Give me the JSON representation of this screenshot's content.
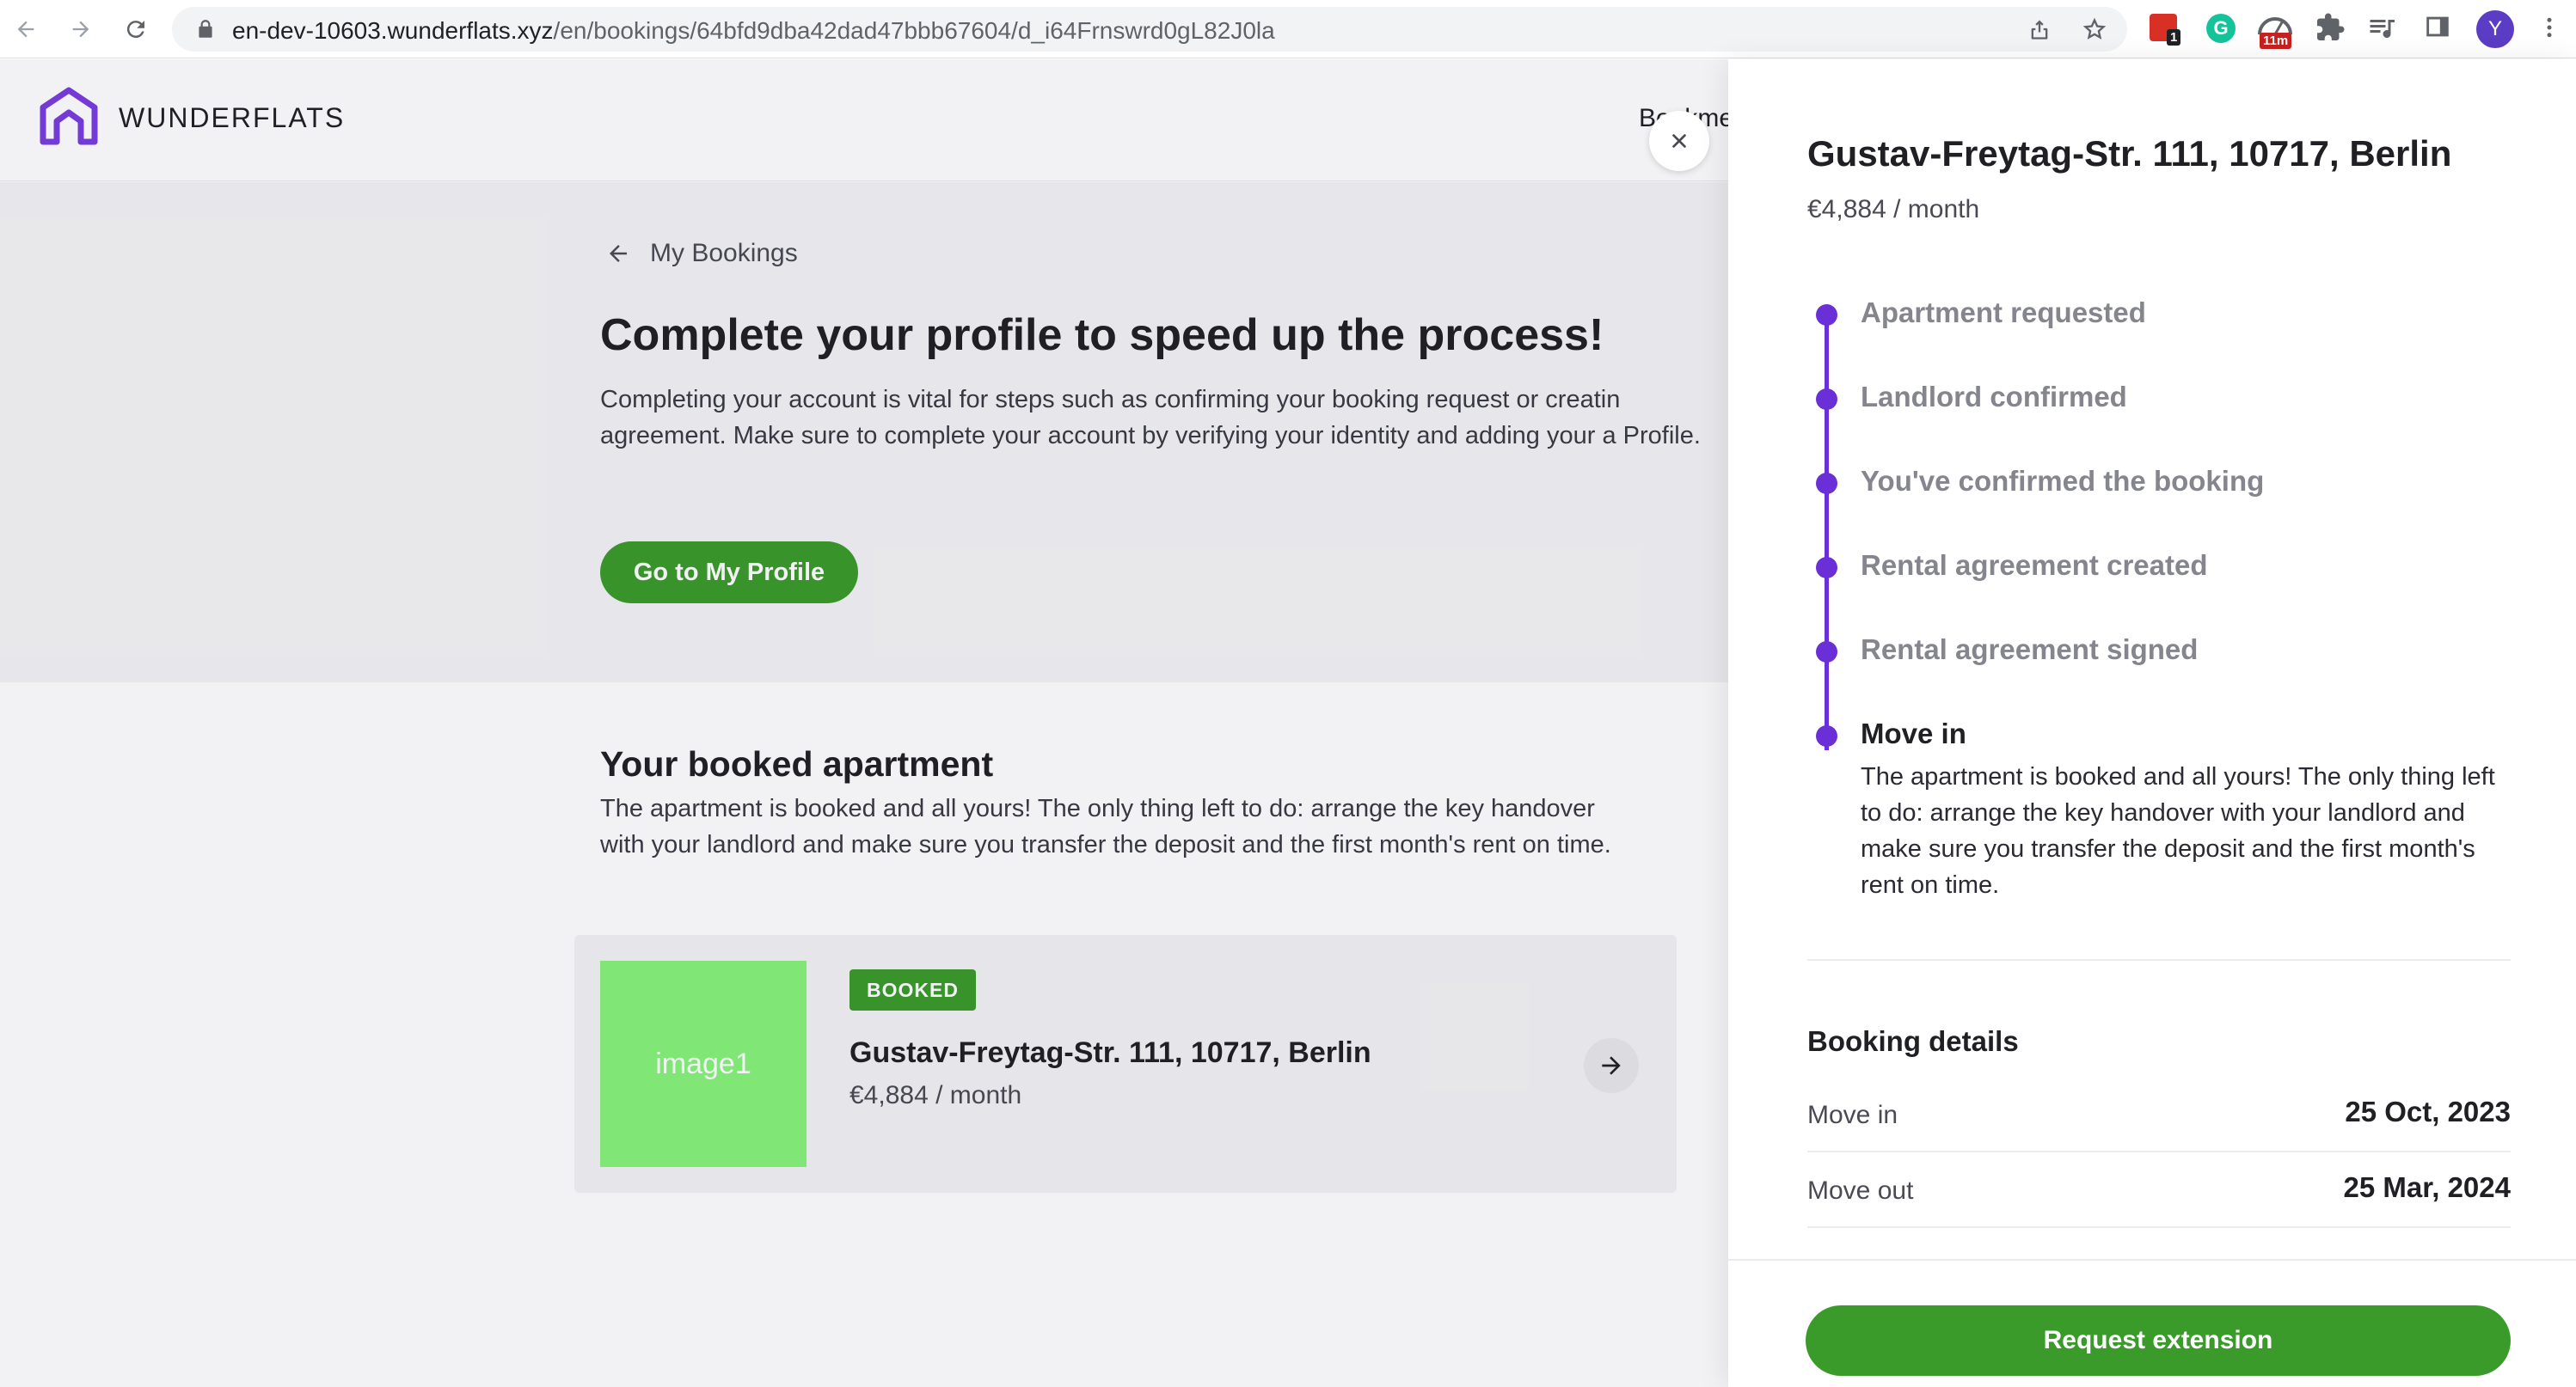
{
  "browser": {
    "url_host": "en-dev-10603.wunderflats.xyz",
    "url_path": "/en/bookings/64bfd9dba42dad47bbb67604/d_i64Frnswrd0gL82J0la",
    "extensions": [
      {
        "name": "calendar-extension-icon",
        "badge": "1"
      },
      {
        "name": "grammarly-icon",
        "badge": ""
      },
      {
        "name": "timer-extension-icon",
        "badge": "11m"
      },
      {
        "name": "puzzle-icon",
        "badge": ""
      },
      {
        "name": "reading-list-icon",
        "badge": ""
      },
      {
        "name": "side-panel-icon",
        "badge": ""
      }
    ],
    "profile_initial": "Y"
  },
  "site": {
    "logo_text": "WUNDERFLATS",
    "header_link": "Bookme"
  },
  "hero": {
    "back_label": "My Bookings",
    "title": "Complete your profile to speed up the process!",
    "description": "Completing your account is vital for steps such as confirming your booking request or creatin agreement. Make sure to complete your account by verifying your identity and adding your a Profile.",
    "button_label": "Go to My Profile"
  },
  "booked": {
    "title": "Your booked apartment",
    "description": "The apartment is booked and all yours! The only thing left to do: arrange the key handover with your landlord and make sure you transfer the deposit and the first month's rent on time.",
    "card": {
      "image_label": "image1",
      "badge": "BOOKED",
      "address": "Gustav-Freytag-Str. 111, 10717, Berlin",
      "price": "€4,884 / month"
    }
  },
  "panel": {
    "title": "Gustav-Freytag-Str. 111, 10717, Berlin",
    "price": "€4,884 / month",
    "steps": [
      {
        "label": "Apartment requested"
      },
      {
        "label": "Landlord confirmed"
      },
      {
        "label": "You've confirmed the booking"
      },
      {
        "label": "Rental agreement created"
      },
      {
        "label": "Rental agreement signed"
      },
      {
        "label": "Move in",
        "description": "The apartment is booked and all yours! The only thing left to do: arrange the key handover with your landlord and make sure you transfer the deposit and the first month's rent on time."
      }
    ],
    "details_title": "Booking details",
    "details": [
      {
        "label": "Move in",
        "value": "25 Oct, 2023"
      },
      {
        "label": "Move out",
        "value": "25 Mar, 2024"
      }
    ],
    "footer_button": "Request extension"
  },
  "colors": {
    "accent_green": "#3b9b2a",
    "timeline_purple": "#6a2fd6",
    "image_placeholder": "#86f37a"
  }
}
